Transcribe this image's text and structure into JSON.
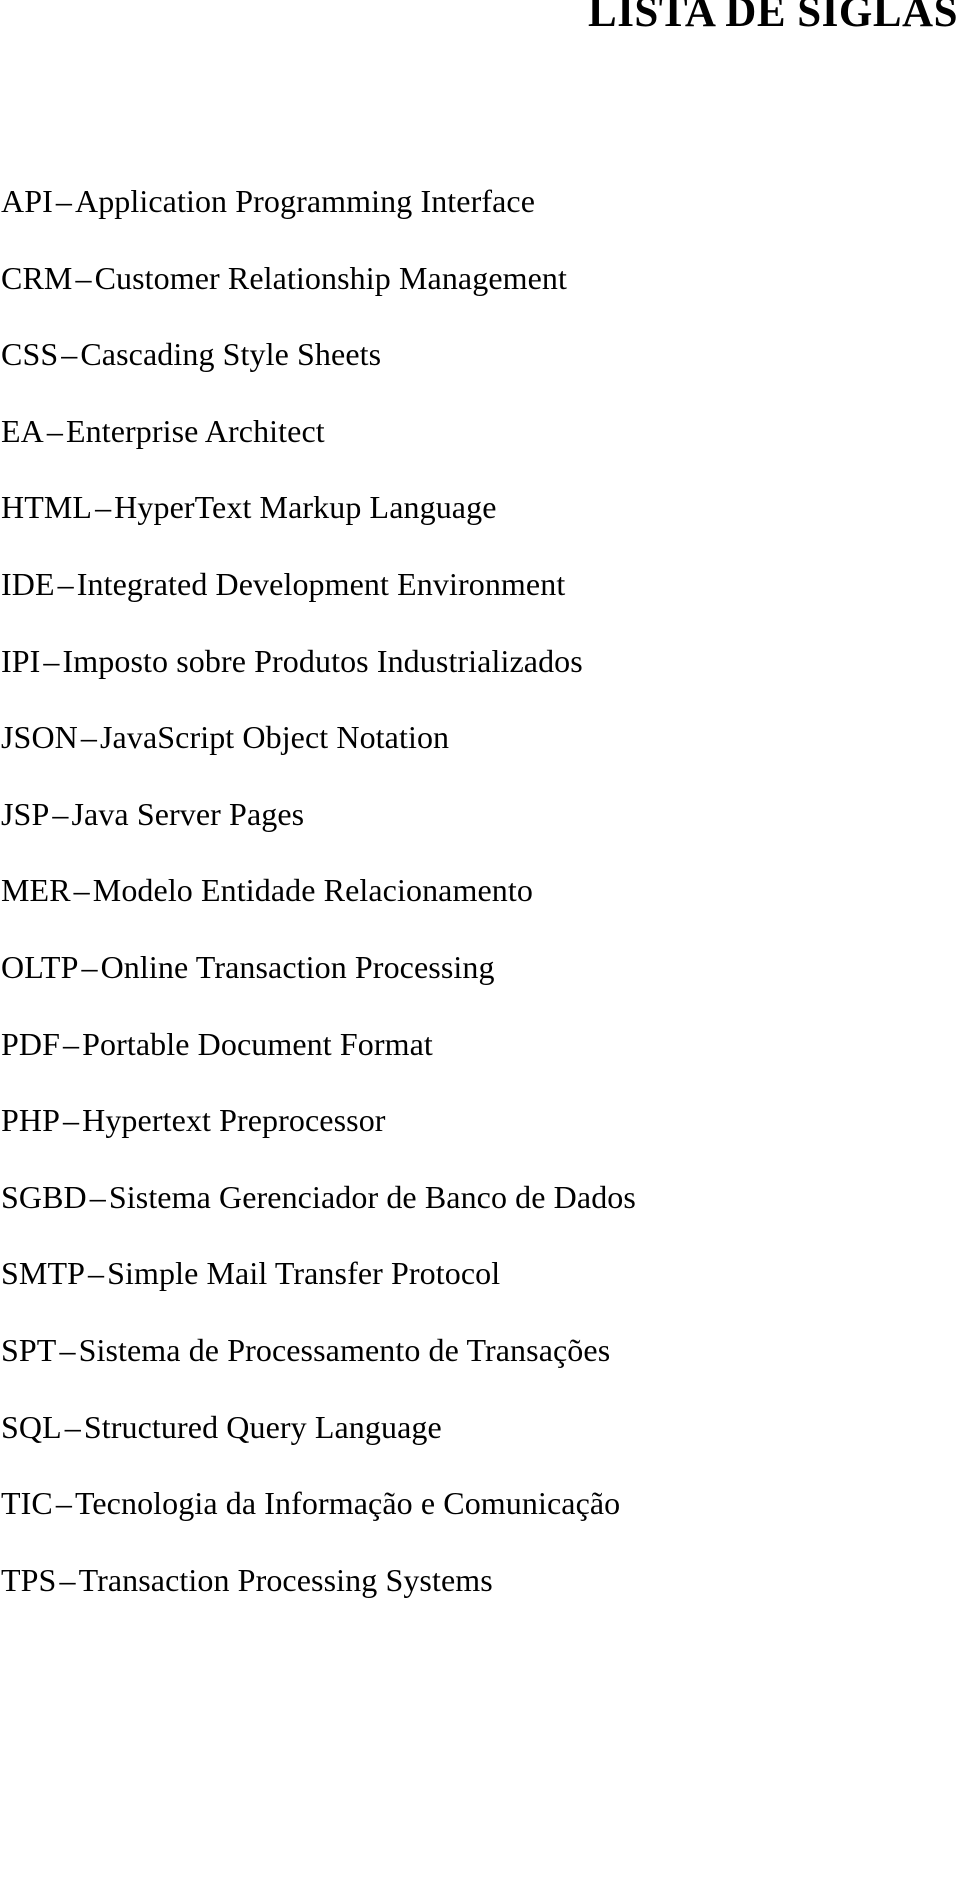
{
  "page": {
    "title": "LISTA DE SIGLAS",
    "language": "pt-BR",
    "background_color": "#ffffff",
    "text_color": "#000000"
  },
  "acronyms": [
    {
      "abbr": "API",
      "dash": "–",
      "meaning": "Application Programming Interface"
    },
    {
      "abbr": "CRM",
      "dash": "–",
      "meaning": "Customer Relationship Management"
    },
    {
      "abbr": "CSS",
      "dash": "–",
      "meaning": "Cascading Style Sheets"
    },
    {
      "abbr": "EA",
      "dash": "–",
      "meaning": "Enterprise Architect"
    },
    {
      "abbr": "HTML",
      "dash": "–",
      "meaning": "HyperText Markup Language"
    },
    {
      "abbr": "IDE",
      "dash": "–",
      "meaning": "Integrated Development Environment"
    },
    {
      "abbr": "IPI",
      "dash": "–",
      "meaning": "Imposto sobre Produtos Industrializados"
    },
    {
      "abbr": "JSON",
      "dash": "–",
      "meaning": "JavaScript Object Notation"
    },
    {
      "abbr": "JSP",
      "dash": "–",
      "meaning": "Java Server Pages"
    },
    {
      "abbr": "MER",
      "dash": "–",
      "meaning": "Modelo Entidade Relacionamento"
    },
    {
      "abbr": "OLTP",
      "dash": "–",
      "meaning": "Online Transaction Processing"
    },
    {
      "abbr": "PDF",
      "dash": "–",
      "meaning": "Portable Document Format"
    },
    {
      "abbr": "PHP",
      "dash": "–",
      "meaning": "Hypertext Preprocessor"
    },
    {
      "abbr": "SGBD",
      "dash": "–",
      "meaning": "Sistema Gerenciador de Banco de Dados"
    },
    {
      "abbr": "SMTP",
      "dash": "–",
      "meaning": "Simple Mail Transfer Protocol"
    },
    {
      "abbr": "SPT",
      "dash": "–",
      "meaning": "Sistema de Processamento de Transações"
    },
    {
      "abbr": "SQL",
      "dash": "–",
      "meaning": "Structured Query Language"
    },
    {
      "abbr": "TIC",
      "dash": "–",
      "meaning": "Tecnologia da Informação e Comunicação"
    },
    {
      "abbr": "TPS",
      "dash": "–",
      "meaning": "Transaction Processing Systems"
    }
  ]
}
